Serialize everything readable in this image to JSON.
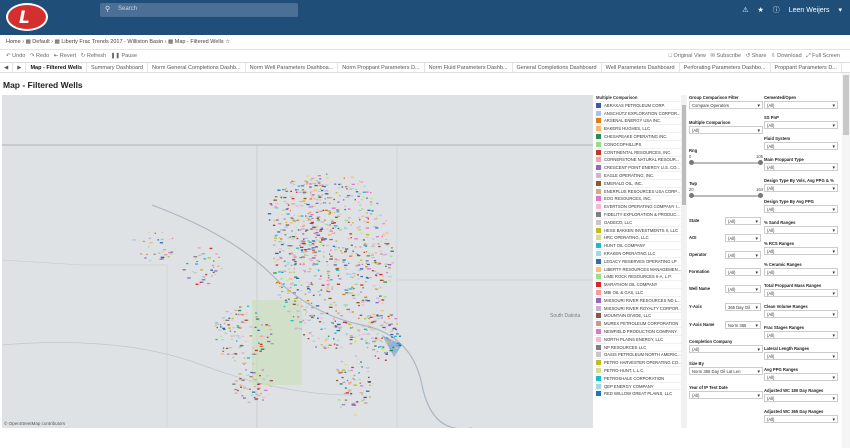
{
  "header": {
    "search_placeholder": "Search",
    "user": "Leen Weijers"
  },
  "breadcrumb": {
    "home": "Home",
    "default": "Default",
    "workbook": "Liberty Frac Trends 2017 - Williston Basin",
    "view": "Map - Filtered Wells"
  },
  "toolbar": {
    "undo": "Undo",
    "redo": "Redo",
    "revert": "Revert",
    "refresh": "Refresh",
    "pause": "Pause",
    "original_view": "Original View",
    "subscribe": "Subscribe",
    "share": "Share",
    "download": "Download",
    "full_screen": "Full Screen"
  },
  "tabs": [
    "Map - Filtered Wells",
    "Summary Dashboard",
    "Norm General Completions Dashb...",
    "Norm Well Parameters Dashboa...",
    "Norm Proppant Parameters D...",
    "Norm Fluid Parameters Dashb...",
    "General Completions Dashboard",
    "Well Parameters Dashboard",
    "Perforating Parameters Dashbo...",
    "Proppant Parameters D..."
  ],
  "page_title": "Map - Filtered Wells",
  "map": {
    "credit": "© OpenStreetMap contributors",
    "label_south_dakota": "South Dakota"
  },
  "legend": {
    "title": "Multiple Comparison",
    "items": [
      {
        "name": "ABRAXAS PETROLEUM CORP.",
        "color": "#3b5aa8"
      },
      {
        "name": "ANSCHUTZ EXPLORATION CORPOR...",
        "color": "#a9c4e8"
      },
      {
        "name": "ARSENAL ENERGY USA INC.",
        "color": "#e07b1a"
      },
      {
        "name": "BAKERS HUGHES, LLC",
        "color": "#f7b66b"
      },
      {
        "name": "CHESAPEAKE OPERATING INC.",
        "color": "#2e8b57"
      },
      {
        "name": "CONOCOPHILLIPS",
        "color": "#9fd88c"
      },
      {
        "name": "CONTINENTAL RESOURCES, INC.",
        "color": "#c0392b"
      },
      {
        "name": "CORNERSTONE NATURAL RESOUR...",
        "color": "#f4a3a0"
      },
      {
        "name": "CRESCENT POINT ENERGY U.S. CO...",
        "color": "#8e6bb8"
      },
      {
        "name": "EAGLE OPERATING, INC.",
        "color": "#c8b4de"
      },
      {
        "name": "EMERALD OIL, INC.",
        "color": "#8b5a2b"
      },
      {
        "name": "ENERPLUS RESOURCES USA CORP...",
        "color": "#d2ab8a"
      },
      {
        "name": "EOG RESOURCES, INC.",
        "color": "#e377c2"
      },
      {
        "name": "EVERTSON OPERATING COMPANY I...",
        "color": "#f7b6d2"
      },
      {
        "name": "FIDELITY EXPLORATION & PRODUC...",
        "color": "#7f7f7f"
      },
      {
        "name": "GADECO, LLC",
        "color": "#c7c7c7"
      },
      {
        "name": "HESS BAKKEN INVESTMENTS II, LLC",
        "color": "#bcbd22"
      },
      {
        "name": "HRC OPERATING, LLC",
        "color": "#dbdb8d"
      },
      {
        "name": "HUNT OIL COMPANY",
        "color": "#17becf"
      },
      {
        "name": "KRAKEN OPERATING LLC",
        "color": "#9edae5"
      },
      {
        "name": "LEGACY RESERVES OPERATING LP",
        "color": "#2a6fb0"
      },
      {
        "name": "LIBERTY RESOURCES MANAGEMEN...",
        "color": "#ffbb78"
      },
      {
        "name": "LIME ROCK RESOURCES II-A, L.P.",
        "color": "#98df8a"
      },
      {
        "name": "MARATHON OIL COMPANY",
        "color": "#d62728"
      },
      {
        "name": "MBI OIL & GAS, LLC",
        "color": "#ff9896"
      },
      {
        "name": "MISSOURI RIVER RESOURCES ND L...",
        "color": "#9467bd"
      },
      {
        "name": "MISSOURI RIVER ROYALTY CORPOR...",
        "color": "#c5b0d5"
      },
      {
        "name": "MOUNTAIN DIVIDE, LLC",
        "color": "#8c564b"
      },
      {
        "name": "MUREX PETROLEUM CORPORATION",
        "color": "#c49c94"
      },
      {
        "name": "NEWFIELD PRODUCTION COMPANY",
        "color": "#e377c2"
      },
      {
        "name": "NORTH PLAINS ENERGY, LLC",
        "color": "#f7b6d2"
      },
      {
        "name": "NP RESOURCES LLC",
        "color": "#7f7f7f"
      },
      {
        "name": "OASIS PETROLEUM NORTH AMERIC...",
        "color": "#c7c7c7"
      },
      {
        "name": "PETRO HARVESTER OPERATING CO...",
        "color": "#bcbd22"
      },
      {
        "name": "PETRO-HUNT, L.L.C.",
        "color": "#dbdb8d"
      },
      {
        "name": "PETROSHALE CORPORATION",
        "color": "#17becf"
      },
      {
        "name": "QEP ENERGY COMPANY",
        "color": "#9edae5"
      },
      {
        "name": "RED WILLOW GREAT PLAINS, LLC",
        "color": "#1f77b4"
      }
    ]
  },
  "filters_col1": {
    "group_comparison_filter": {
      "label": "Group Comparison Filter",
      "value": "Compare Operators"
    },
    "multiple_comparison": {
      "label": "Multiple Comparison",
      "value": "(All)"
    },
    "rng": {
      "label": "Rng",
      "min": "0",
      "max": "105"
    },
    "twp": {
      "label": "Twp",
      "min": "20",
      "max": "164"
    },
    "state": {
      "label": "State",
      "value": "(All)"
    },
    "aoi": {
      "label": "AOI",
      "value": "(All)"
    },
    "operator": {
      "label": "Operator",
      "value": "(All)"
    },
    "formation": {
      "label": "Formation",
      "value": "(All)"
    },
    "well_name": {
      "label": "Well Name",
      "value": "(All)"
    },
    "y_axis": {
      "label": "Y-Axis",
      "value": "365 Day Oil"
    },
    "y_axis_name": {
      "label": "Y-Axis Name",
      "value": "Norm 365"
    },
    "completion_company": {
      "label": "Completion Company",
      "value": "(All)"
    },
    "size_by": {
      "label": "Size By",
      "value": "Norm 365 Day Oil Lat Len"
    },
    "year_of_ip_test_date": {
      "label": "Year of IP Test Date",
      "value": "(All)"
    }
  },
  "filters_col2": [
    {
      "label": "Cemented/Open",
      "value": "(All)"
    },
    {
      "label": "SS PnP",
      "value": "(All)"
    },
    {
      "label": "Fluid System",
      "value": "(All)"
    },
    {
      "label": "Main Proppant Type",
      "value": "(All)"
    },
    {
      "label": "Design Type By Vols, Avg PPG & % Ce...",
      "value": "(All)"
    },
    {
      "label": "Design Type By Avg PPG",
      "value": "(All)"
    },
    {
      "label": "% Sand Ranges",
      "value": "(All)"
    },
    {
      "label": "% RCS Ranges",
      "value": "(All)"
    },
    {
      "label": "% Ceramic Ranges",
      "value": "(All)"
    },
    {
      "label": "Total Proppant Mass Ranges",
      "value": "(All)"
    },
    {
      "label": "Clean Volume Ranges",
      "value": "(All)"
    },
    {
      "label": "Frac Stages Ranges",
      "value": "(All)"
    },
    {
      "label": "Lateral Length Ranges",
      "value": "(All)"
    },
    {
      "label": "Avg PPG Ranges",
      "value": "(All)"
    },
    {
      "label": "Adjusted WC 180 Day Ranges",
      "value": "(All)"
    },
    {
      "label": "Adjusted WC 365 Day Ranges",
      "value": "(All)"
    }
  ]
}
